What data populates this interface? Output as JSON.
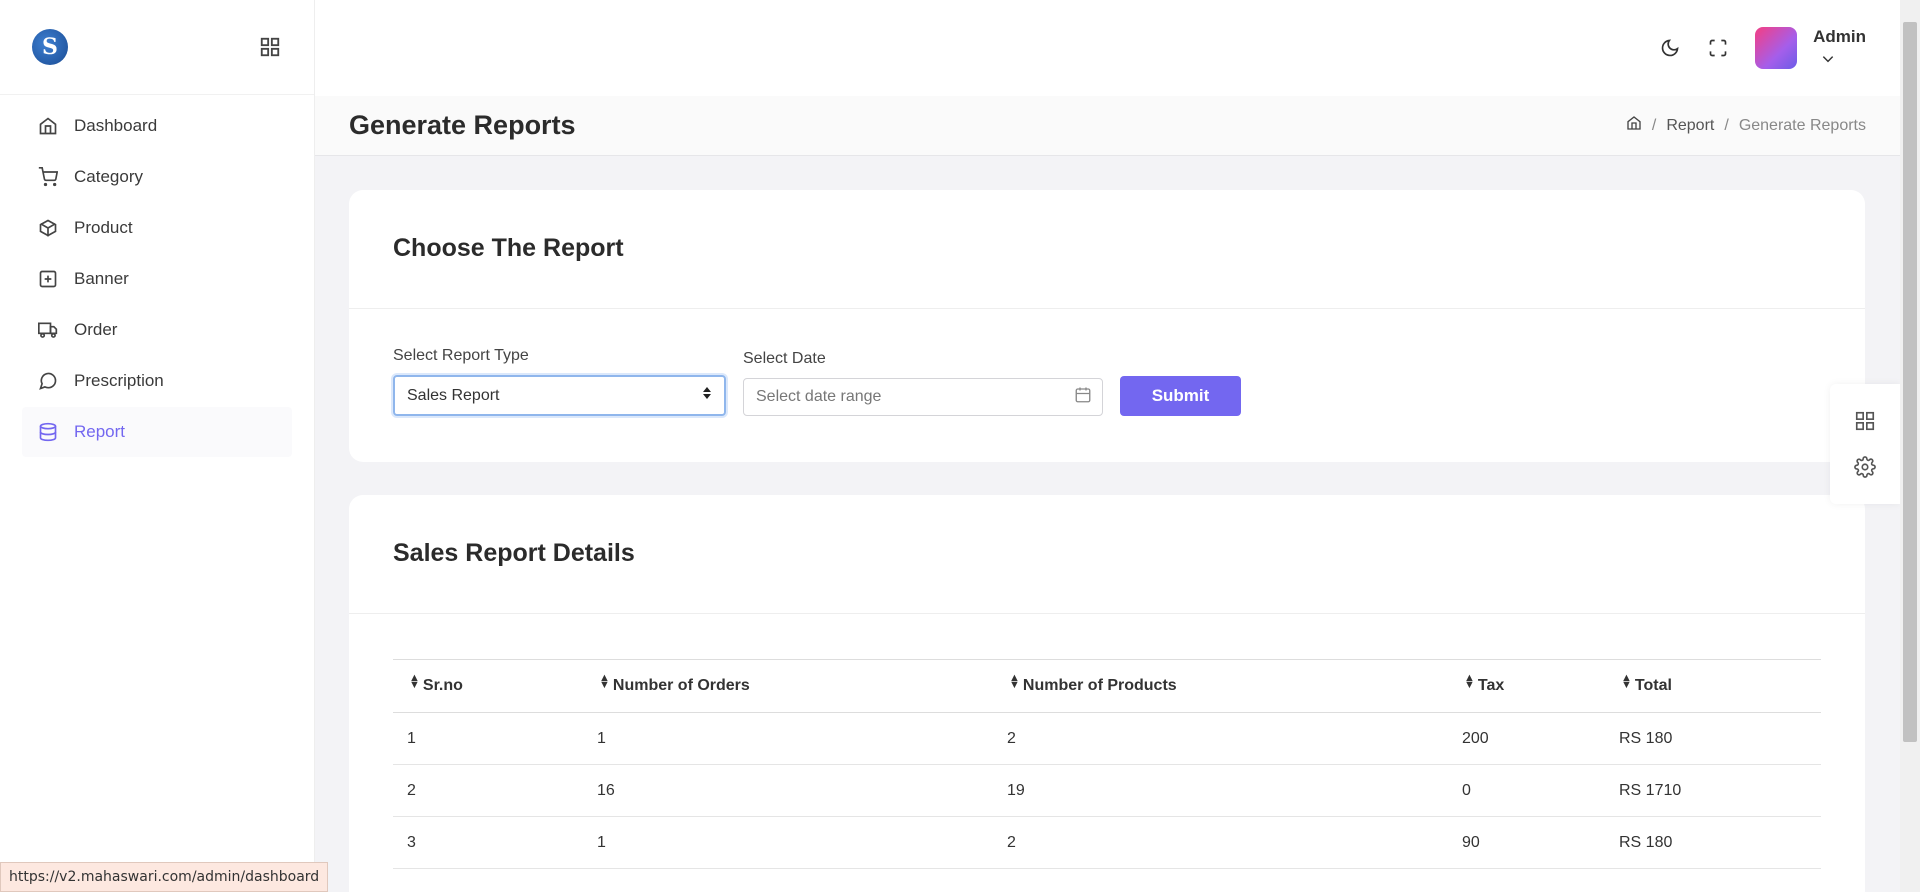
{
  "sidebar": {
    "logo_letter": "S",
    "items": [
      {
        "label": "Dashboard",
        "icon": "home-icon"
      },
      {
        "label": "Category",
        "icon": "cart-icon"
      },
      {
        "label": "Product",
        "icon": "box-icon"
      },
      {
        "label": "Banner",
        "icon": "plus-square-icon"
      },
      {
        "label": "Order",
        "icon": "truck-icon"
      },
      {
        "label": "Prescription",
        "icon": "message-circle-icon"
      },
      {
        "label": "Report",
        "icon": "database-icon",
        "active": true
      }
    ]
  },
  "header": {
    "user_name": "Admin"
  },
  "titlebar": {
    "title": "Generate Reports",
    "breadcrumb": [
      "Report",
      "Generate Reports"
    ]
  },
  "report_card": {
    "title": "Choose The Report",
    "type_label": "Select Report Type",
    "type_value": "Sales Report",
    "date_label": "Select Date",
    "date_placeholder": "Select date range",
    "submit_label": "Submit"
  },
  "details_card": {
    "title": "Sales Report Details",
    "columns": [
      "Sr.no",
      "Number of Orders",
      "Number of Products",
      "Tax",
      "Total"
    ],
    "rows": [
      [
        "1",
        "1",
        "2",
        "200",
        "RS 180"
      ],
      [
        "2",
        "16",
        "19",
        "0",
        "RS 1710"
      ],
      [
        "3",
        "1",
        "2",
        "90",
        "RS 180"
      ]
    ]
  },
  "status_url": "https://v2.mahaswari.com/admin/dashboard",
  "colors": {
    "accent": "#7367f0",
    "background": "#f3f3f6"
  }
}
